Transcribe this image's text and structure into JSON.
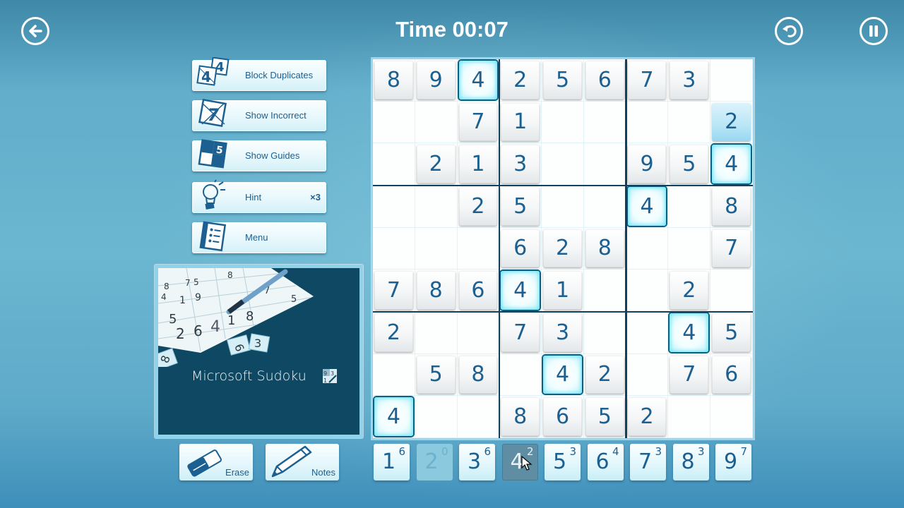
{
  "header": {
    "timer_label": "Time 00:07",
    "back_icon": "arrow-left-circle-icon",
    "undo_icon": "undo-circle-icon",
    "pause_icon": "pause-circle-icon"
  },
  "options": [
    {
      "id": "block-duplicates",
      "label": "Block Duplicates",
      "icon": "block-duplicates-icon",
      "count": ""
    },
    {
      "id": "show-incorrect",
      "label": "Show Incorrect",
      "icon": "show-incorrect-icon",
      "count": ""
    },
    {
      "id": "show-guides",
      "label": "Show Guides",
      "icon": "show-guides-icon",
      "count": ""
    },
    {
      "id": "hint",
      "label": "Hint",
      "icon": "lightbulb-icon",
      "count": "×3"
    },
    {
      "id": "menu",
      "label": "Menu",
      "icon": "menu-list-icon",
      "count": ""
    }
  ],
  "promo": {
    "title": "Microsoft Sudoku",
    "logo_icon": "sudoku-logo-icon"
  },
  "tools": {
    "erase_label": "Erase",
    "notes_label": "Notes"
  },
  "board": {
    "highlight_value": 4,
    "selected_cell": [
      1,
      8
    ],
    "rows": [
      [
        8,
        9,
        4,
        2,
        5,
        6,
        7,
        3,
        0
      ],
      [
        0,
        0,
        7,
        1,
        0,
        0,
        0,
        0,
        2
      ],
      [
        0,
        2,
        1,
        3,
        0,
        0,
        9,
        5,
        4
      ],
      [
        0,
        0,
        2,
        5,
        0,
        0,
        4,
        0,
        8
      ],
      [
        0,
        0,
        0,
        6,
        2,
        8,
        0,
        0,
        7
      ],
      [
        7,
        8,
        6,
        4,
        1,
        0,
        0,
        2,
        0
      ],
      [
        2,
        0,
        0,
        7,
        3,
        0,
        0,
        4,
        5
      ],
      [
        0,
        5,
        8,
        0,
        4,
        2,
        0,
        7,
        6
      ],
      [
        4,
        0,
        0,
        8,
        6,
        5,
        2,
        0,
        0
      ]
    ]
  },
  "numpad": [
    {
      "digit": "1",
      "remaining": "6",
      "state": "normal"
    },
    {
      "digit": "2",
      "remaining": "0",
      "state": "done"
    },
    {
      "digit": "3",
      "remaining": "6",
      "state": "normal"
    },
    {
      "digit": "4",
      "remaining": "2",
      "state": "active"
    },
    {
      "digit": "5",
      "remaining": "3",
      "state": "normal"
    },
    {
      "digit": "6",
      "remaining": "4",
      "state": "normal"
    },
    {
      "digit": "7",
      "remaining": "3",
      "state": "normal"
    },
    {
      "digit": "8",
      "remaining": "3",
      "state": "normal"
    },
    {
      "digit": "9",
      "remaining": "7",
      "state": "normal"
    }
  ]
}
